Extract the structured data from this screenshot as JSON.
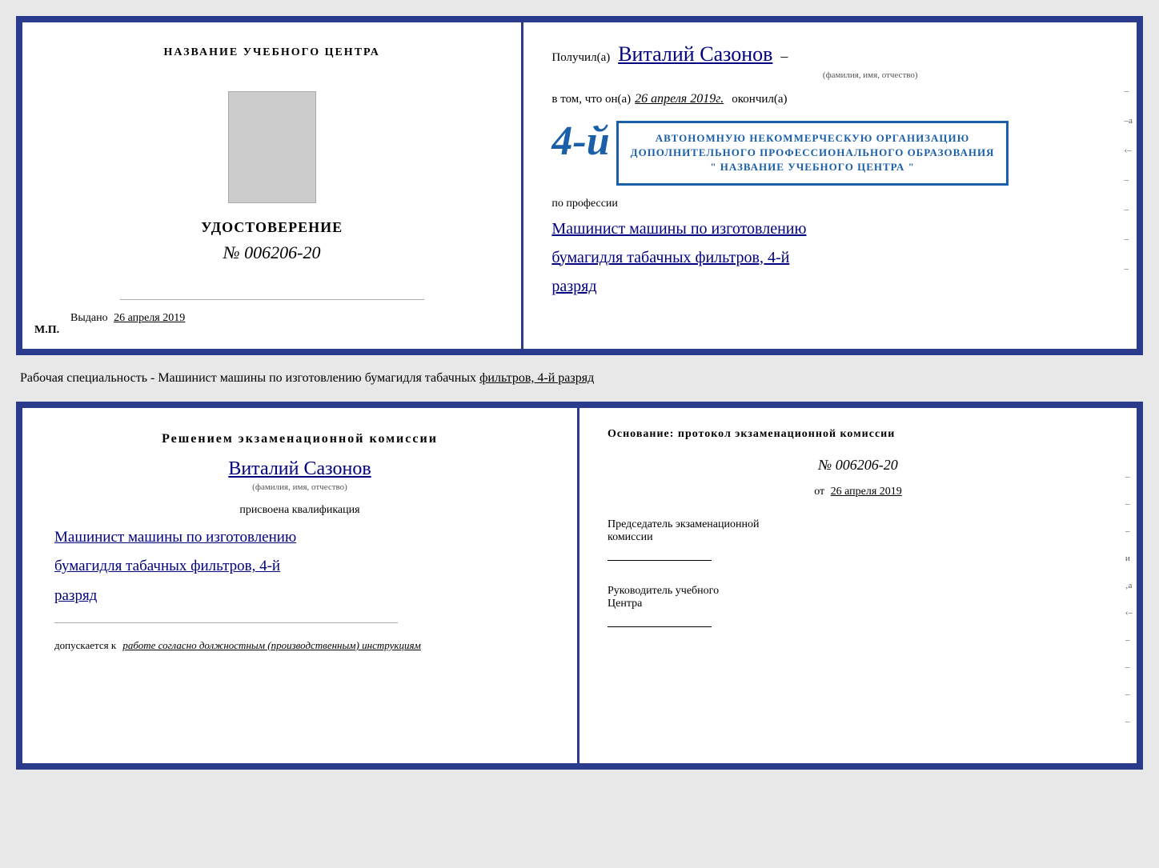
{
  "top_cert": {
    "left": {
      "training_center_label": "НАЗВАНИЕ УЧЕБНОГО ЦЕНТРА",
      "photo_alt": "photo",
      "udostoverenie_title": "УДОСТОВЕРЕНИЕ",
      "udostoverenie_number": "№ 006206-20",
      "vydano_label": "Выдано",
      "vydano_date": "26 апреля 2019",
      "mp_label": "М.П."
    },
    "right": {
      "poluchil_prefix": "Получил(а)",
      "poluchil_name": "Виталий Сазонов",
      "poluchil_subtitle": "(фамилия, имя, отчество)",
      "poluchil_dash": "–",
      "vtom_prefix": "в том, что он(а)",
      "vtom_date": "26 апреля 2019г.",
      "okonchil": "окончил(а)",
      "stamp_number": "4-й",
      "stamp_line1": "АВТОНОМНУЮ НЕКОММЕРЧЕСКУЮ ОРГАНИЗАЦИЮ",
      "stamp_line2": "ДОПОЛНИТЕЛЬНОГО ПРОФЕССИОНАЛЬНОГО ОБРАЗОВАНИЯ",
      "stamp_line3": "\" НАЗВАНИЕ УЧЕБНОГО ЦЕНТРА \"",
      "po_professii": "по профессии",
      "profession_line1": "Машинист машины по изготовлению",
      "profession_line2": "бумагидля табачных фильтров, 4-й",
      "profession_line3": "разряд",
      "right_marks": [
        "–",
        "–а",
        "‹–",
        "–",
        "–",
        "–",
        "–"
      ]
    }
  },
  "subtitle": {
    "text_normal": "Рабочая специальность - Машинист машины по изготовлению бумагидля табачных ",
    "text_underlined": "фильтров, 4-й разряд"
  },
  "bottom_cert": {
    "left": {
      "resheniem_title": "Решением  экзаменационной  комиссии",
      "person_name": "Виталий Сазонов",
      "fio_subtitle": "(фамилия, имя, отчество)",
      "prisvoena_label": "присвоена квалификация",
      "qual_line1": "Машинист машины по изготовлению",
      "qual_line2": "бумагидля табачных фильтров, 4-й",
      "qual_line3": "разряд",
      "dopuskaetsya_prefix": "допускается к",
      "dopuskaetsya_value": "работе согласно должностным (производственным) инструкциям"
    },
    "right": {
      "osnovaniye_title": "Основание: протокол экзаменационной  комиссии",
      "protocol_number": "№  006206-20",
      "ot_prefix": "от",
      "ot_date": "26 апреля 2019",
      "predsedatel_line1": "Председатель экзаменационной",
      "predsedatel_line2": "комиссии",
      "rukovoditel_line1": "Руководитель учебного",
      "rukovoditel_line2": "Центра",
      "right_marks": [
        "–",
        "–",
        "–",
        "и",
        "‚а",
        "‹–",
        "–",
        "–",
        "–",
        "–"
      ]
    }
  }
}
